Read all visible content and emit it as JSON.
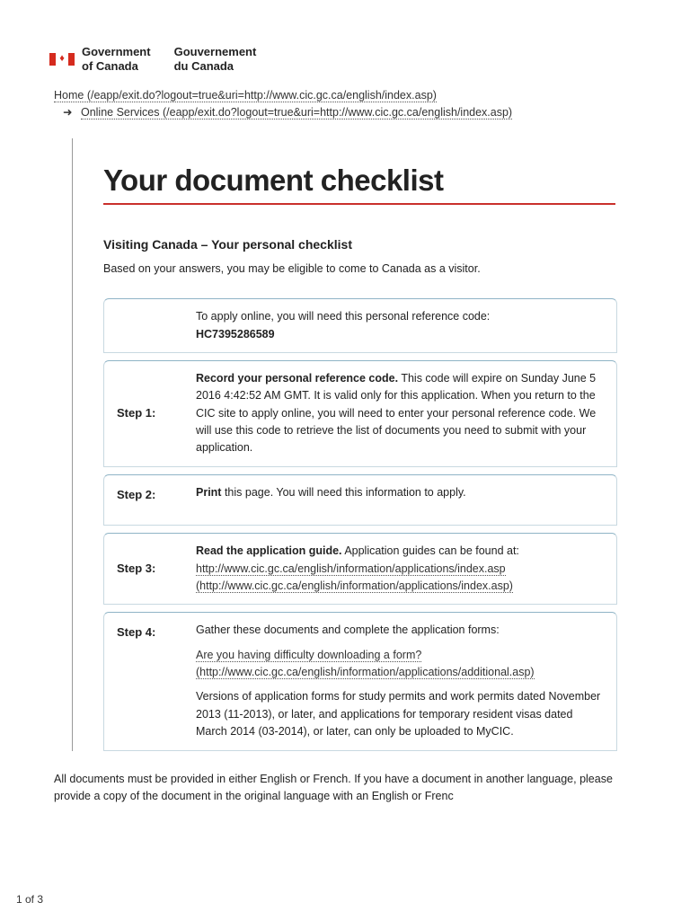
{
  "header": {
    "gov_en_1": "Government",
    "gov_en_2": "of Canada",
    "gov_fr_1": "Gouvernement",
    "gov_fr_2": "du Canada"
  },
  "breadcrumb": {
    "home": "Home (/eapp/exit.do?logout=true&uri=http://www.cic.gc.ca/english/index.asp)",
    "arrow": "➜",
    "online": "Online Services (/eapp/exit.do?logout=true&uri=http://www.cic.gc.ca/english/index.asp)"
  },
  "title": "Your document checklist",
  "subtitle": "Visiting Canada – Your personal checklist",
  "intro": "Based on your answers, you may be eligible to come to Canada as a visitor.",
  "box0": {
    "line1": "To apply online, you will need this personal reference code:",
    "code": "HC7395286589"
  },
  "steps": {
    "s1_label": "Step 1:",
    "s1_bold": "Record your personal reference code.",
    "s1_text": " This code will expire on Sunday June 5 2016 4:42:52 AM GMT. It is valid only for this application. When you return to the CIC site to apply online, you will need to enter your personal reference code. We will use this code to retrieve the list of documents you need to submit with your application.",
    "s2_label": "Step 2:",
    "s2_bold": "Print",
    "s2_text": " this page. You will need this information to apply.",
    "s3_label": "Step 3:",
    "s3_bold": "Read the application guide.",
    "s3_text": "  Application guides can be found at: ",
    "s3_link": "http://www.cic.gc.ca/english/information/applications/index.asp (http://www.cic.gc.ca/english/information/applications/index.asp)",
    "s4_label": "Step 4:",
    "s4_p1": "Gather these documents and complete the application forms:",
    "s4_link": "Are you having difficulty downloading a form? (http://www.cic.gc.ca/english/information/applications/additional.asp)",
    "s4_p2": "Versions of application forms for study permits and work permits dated November 2013 (11-2013), or later, and applications for temporary resident visas dated March 2014 (03-2014), or later, can only be uploaded to MyCIC."
  },
  "footer": "All documents must be provided in either English or French. If you have a document in another language, please provide a copy of the document in the original language with an English or Frenc",
  "page": "1 of 3"
}
